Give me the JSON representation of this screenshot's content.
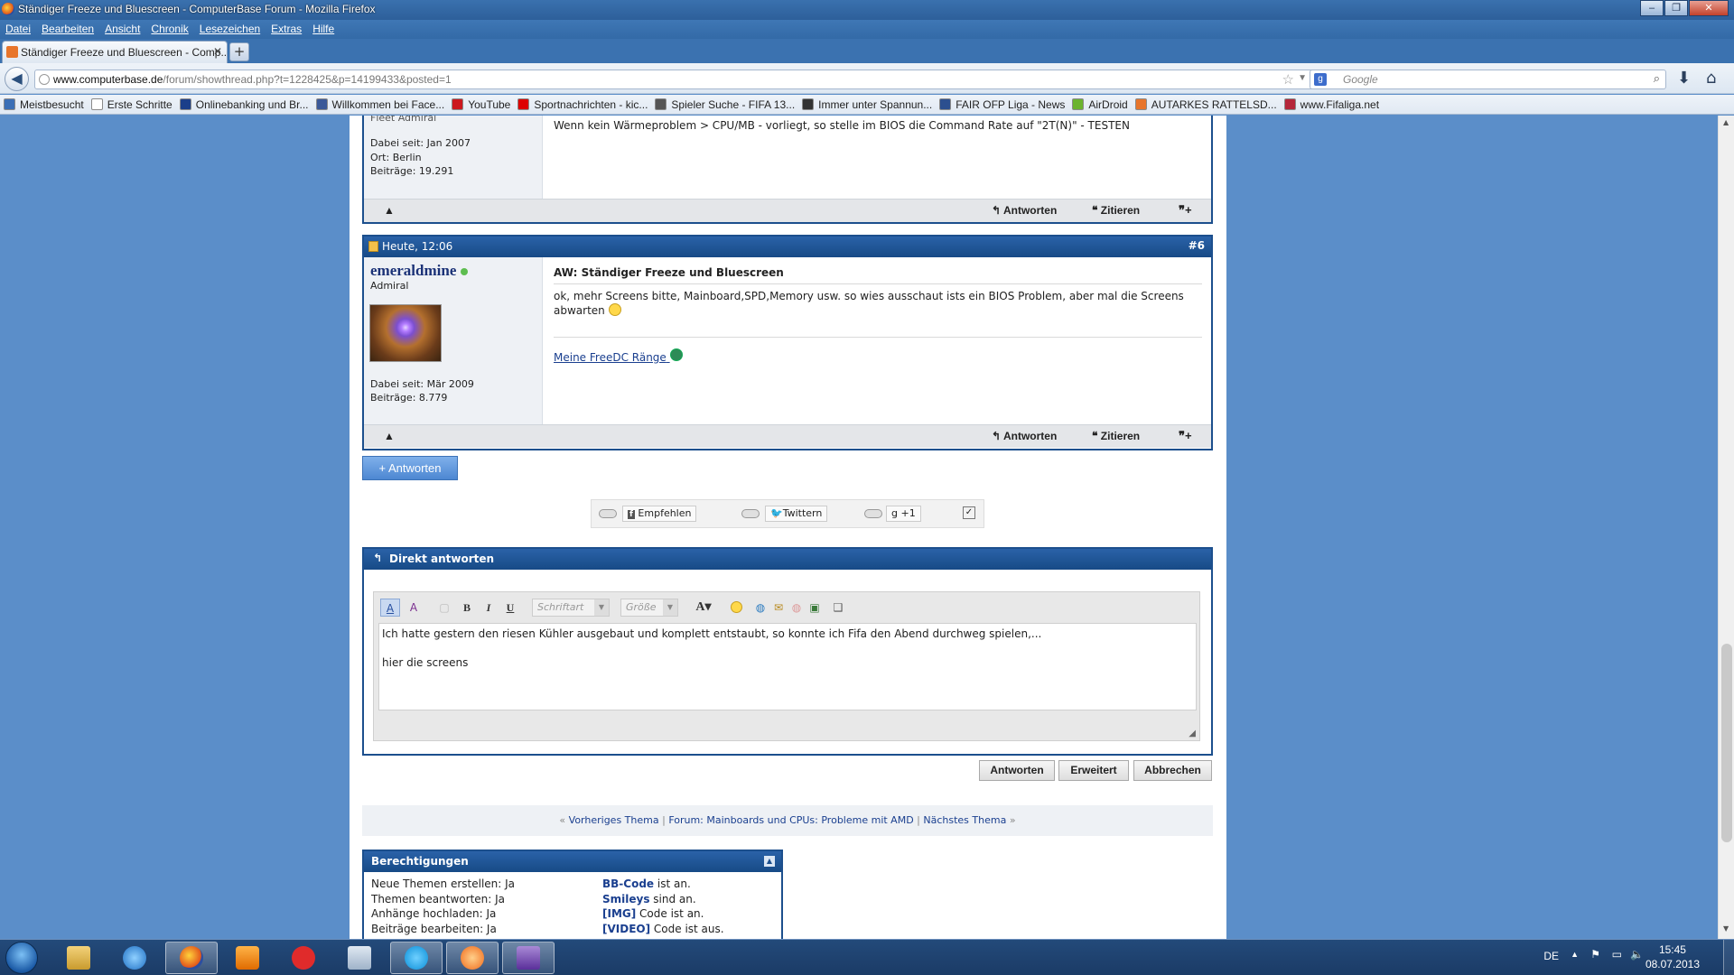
{
  "window": {
    "title": "Ständiger Freeze und Bluescreen - ComputerBase Forum - Mozilla Firefox"
  },
  "menu": [
    "Datei",
    "Bearbeiten",
    "Ansicht",
    "Chronik",
    "Lesezeichen",
    "Extras",
    "Hilfe"
  ],
  "tab": {
    "title": "Ständiger Freeze und Bluescreen - Comp..."
  },
  "url": {
    "host": "www.computerbase.de",
    "path": "/forum/showthread.php?t=1228425&p=14199433&posted=1"
  },
  "search": {
    "placeholder": "Google"
  },
  "bookmarks": [
    {
      "label": "Meistbesucht",
      "color": "#3b6fb6"
    },
    {
      "label": "Erste Schritte",
      "color": "#ffffff"
    },
    {
      "label": "Onlinebanking und Br...",
      "color": "#1b3f8a"
    },
    {
      "label": "Willkommen bei Face...",
      "color": "#3b5998"
    },
    {
      "label": "YouTube",
      "color": "#cc181e"
    },
    {
      "label": "Sportnachrichten - kic...",
      "color": "#d00"
    },
    {
      "label": "Spieler Suche - FIFA 13...",
      "color": "#555"
    },
    {
      "label": "Immer unter Spannun...",
      "color": "#333"
    },
    {
      "label": "FAIR OFP Liga - News",
      "color": "#2c4f8f"
    },
    {
      "label": "AirDroid",
      "color": "#6bb32e"
    },
    {
      "label": "AUTARKES RATTELSD...",
      "color": "#e8752b"
    },
    {
      "label": "www.Fifaliga.net",
      "color": "#b5273a"
    }
  ],
  "post5": {
    "rank_partial": "Fleet Admiral",
    "joined": "Dabei seit: Jan 2007",
    "location": "Ort: Berlin",
    "posts": "Beiträge: 19.291",
    "text": "Wenn kein Wärmeproblem > CPU/MB - vorliegt, so stelle im BIOS die Command Rate auf \"2T(N)\" - TESTEN",
    "answer": "Antworten",
    "quote": "Zitieren"
  },
  "post6": {
    "date": "Heute, 12:06",
    "number": "#6",
    "username": "emeraldmine",
    "rank": "Admiral",
    "joined": "Dabei seit: Mär 2009",
    "posts": "Beiträge: 8.779",
    "title": "AW: Ständiger Freeze und Bluescreen",
    "text": "ok, mehr Screens bitte, Mainboard,SPD,Memory usw. so wies ausschaut ists ein BIOS Problem, aber mal die Screens abwarten",
    "signature": "Meine FreeDC Ränge",
    "answer": "Antworten",
    "quote": "Zitieren"
  },
  "reply_button": "+ Antworten",
  "social": {
    "facebook": "Empfehlen",
    "twitter": "Twittern",
    "gplus": "+1"
  },
  "quick_reply": {
    "header": "Direkt antworten",
    "font_placeholder": "Schriftart",
    "size_placeholder": "Größe",
    "line1": "Ich hatte gestern den riesen Kühler ausgebaut und komplett entstaubt, so konnte ich Fifa den Abend durchweg spielen,...",
    "line2": "hier die screens"
  },
  "buttons": {
    "submit": "Antworten",
    "advanced": "Erweitert",
    "cancel": "Abbrechen"
  },
  "thread_nav": {
    "prev": "Vorheriges Thema",
    "forum": "Forum: Mainboards und CPUs: Probleme mit AMD",
    "next": "Nächstes Thema"
  },
  "permissions": {
    "header": "Berechtigungen",
    "left": [
      "Neue Themen erstellen: Ja",
      "Themen beantworten: Ja",
      "Anhänge hochladen: Ja",
      "Beiträge bearbeiten: Ja"
    ],
    "right": [
      {
        "key": "BB-Code",
        "rest": " ist an."
      },
      {
        "key": "Smileys",
        "rest": " sind an."
      },
      {
        "key": "[IMG]",
        "rest": " Code ist an."
      },
      {
        "key": "[VIDEO]",
        "rest": " Code ist aus."
      }
    ]
  },
  "tray": {
    "lang": "DE",
    "time": "15:45",
    "date": "08.07.2013"
  }
}
